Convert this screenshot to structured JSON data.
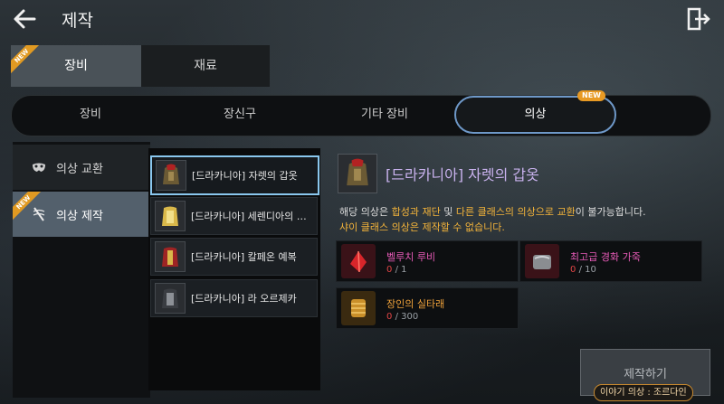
{
  "header": {
    "title": "제작",
    "back_icon": "back-arrow-icon",
    "exit_icon": "exit-door-icon"
  },
  "top_tabs": [
    {
      "label": "장비",
      "new": true,
      "selected": true
    },
    {
      "label": "재료",
      "new": false,
      "selected": false
    }
  ],
  "sub_tabs": [
    {
      "label": "장비"
    },
    {
      "label": "장신구"
    },
    {
      "label": "기타 장비"
    },
    {
      "label": "의상",
      "new": true,
      "selected": true
    }
  ],
  "new_badge": "NEW",
  "categories": [
    {
      "label": "의상 교환",
      "icon": "mask-icon"
    },
    {
      "label": "의상 제작",
      "icon": "needle-thread-icon",
      "new": true,
      "selected": true
    }
  ],
  "list": [
    {
      "name": "[드라카니아] 자렛의 갑옷",
      "selected": true
    },
    {
      "name": "[드라카니아] 세렌디아의 의상"
    },
    {
      "name": "[드라카니아] 칼페온 예복"
    },
    {
      "name": "[드라카니아] 라 오르제카"
    }
  ],
  "detail": {
    "name": "[드라카니아] 자렛의 갑옷",
    "desc_line1": {
      "p1": "해당 의상은 ",
      "h1": "합성과 재단",
      "p2": " 및 ",
      "h2": "다른 클래스의 의상으로 교환",
      "p3": "이 불가능합니다."
    },
    "desc_line2": "샤이 클래스 의상은 제작할 수 없습니다."
  },
  "materials": [
    {
      "name": "벨루치 루비",
      "current": "0",
      "sep": "/",
      "required": "1",
      "name_color": "#e85bb8"
    },
    {
      "name": "최고급 경화 가죽",
      "current": "0",
      "sep": "/",
      "required": "10",
      "name_color": "#e85bb8"
    },
    {
      "name": "장인의 실타래",
      "current": "0",
      "sep": "/",
      "required": "300",
      "name_color": "#f0a23a"
    }
  ],
  "craft_button": "제작하기",
  "story_tag": "이야기 의상 : 조르다인",
  "colors": {
    "accent_blue": "#6e98c8",
    "new_orange": "#e19a22",
    "item_purple": "#c9b2ee",
    "warning_orange": "#f4b43a"
  }
}
